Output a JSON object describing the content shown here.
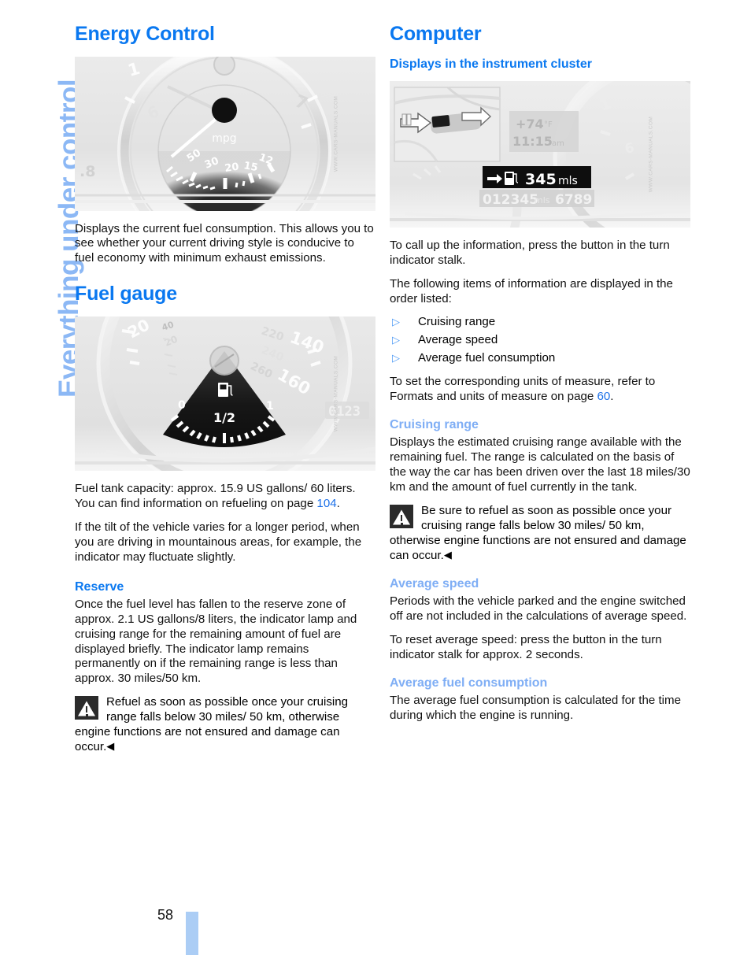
{
  "sidebar": {
    "chapter_label": "Everything under control"
  },
  "footer": {
    "page_number": "58"
  },
  "left_column": {
    "heading": "Energy Control",
    "figure_energy": {
      "credit": "WWW.CARS-MANUALS.COM",
      "unit_label": "mpg",
      "scale_labels": [
        "50",
        "30",
        "20",
        "15",
        "12"
      ],
      "tach_labels": [
        "1",
        "6",
        "7"
      ],
      "corner_label": ".8"
    },
    "paragraph_1": "Displays the current fuel consumption. This allows you to see whether your current driving style is conducive to fuel economy with minimum exhaust emissions.",
    "heading_2": "Fuel gauge",
    "figure_fuel": {
      "credit": "WWW.CARS-MANUALS.COM",
      "gauge_labels": [
        "0",
        "1/2",
        "1"
      ],
      "speedo_labels": [
        "20",
        "40",
        "20",
        "220",
        "240",
        "260",
        "140",
        "160"
      ],
      "odometer": "0123",
      "icon": "fuel-pump-icon"
    },
    "paragraph_2_pre": "Fuel tank capacity: approx. 15.9 US gallons/ 60 liters. You can find information on refueling on page ",
    "paragraph_2_link": "104",
    "paragraph_2_post": ".",
    "paragraph_3": "If the tilt of the vehicle varies for a longer period, when you are driving in mountainous areas, for example, the indicator may fluctuate slightly.",
    "subheading_reserve": "Reserve",
    "paragraph_4": "Once the fuel level has fallen to the reserve zone of approx. 2.1 US gallons/8 liters, the indicator lamp and cruising range for the remaining amount of fuel are displayed briefly. The indicator lamp remains permanently on if the remaining range is less than approx. 30 miles/50 km.",
    "warning": "Refuel as soon as possible once your cruising range falls below 30 miles/ 50 km, otherwise engine functions are not ensured and damage can occur.",
    "warning_endmark": "◀"
  },
  "right_column": {
    "heading": "Computer",
    "subheading_displays": "Displays in the instrument cluster",
    "figure_cluster": {
      "credit": "WWW.CARS-MANUALS.COM",
      "temperature": "+74",
      "temperature_unit": "°F",
      "clock": "11:15",
      "clock_suffix": "am",
      "range_value": "345",
      "range_unit": "mls",
      "odometer": "012345",
      "odometer_unit": "mls",
      "trip": "6789",
      "icons": [
        "fuel-pump-icon",
        "arrow-right-icon",
        "stalk-button-icon"
      ]
    },
    "paragraph_1": "To call up the information, press the button in the turn indicator stalk.",
    "paragraph_2": "The following items of information are displayed in the order listed:",
    "bullets": [
      "Cruising range",
      "Average speed",
      "Average fuel consumption"
    ],
    "paragraph_3_pre": "To set the corresponding units of measure, refer to Formats and units of measure on page ",
    "paragraph_3_link": "60",
    "paragraph_3_post": ".",
    "subheading_cruising": "Cruising range",
    "paragraph_4": "Displays the estimated cruising range available with the remaining fuel. The range is calculated on the basis of the way the car has been driven over the last 18 miles/30 km and the amount of fuel currently in the tank.",
    "warning": "Be sure to refuel as soon as possible once your cruising range falls below 30 miles/ 50 km, otherwise engine functions are not ensured and damage can occur.",
    "warning_endmark": "◀",
    "subheading_avg_speed": "Average speed",
    "paragraph_5": "Periods with the vehicle parked and the engine switched off are not included in the calculations of average speed.",
    "paragraph_6": "To reset average speed: press the button in the turn indicator stalk for approx. 2 seconds.",
    "subheading_avg_fuel": "Average fuel consumption",
    "paragraph_7": "The average fuel consumption is calculated for the time during which the engine is running."
  },
  "colors": {
    "heading_blue": "#0A78F0",
    "subheading_light_blue": "#7FAEF5",
    "sidebar_blue": "#8CB8F5",
    "page_bar_blue": "#ABCDF5",
    "link_blue": "#1A6FE8"
  }
}
